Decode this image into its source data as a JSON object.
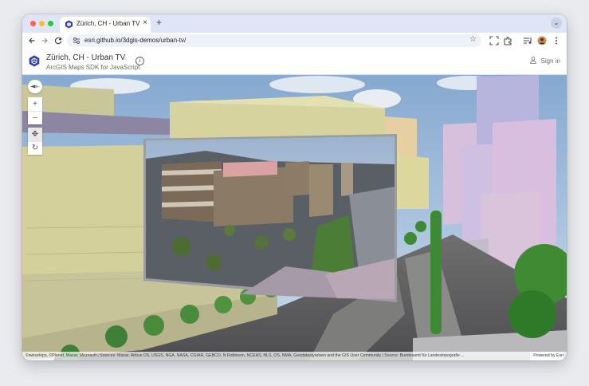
{
  "browser": {
    "tab_title": "Zürich, CH - Urban TV",
    "tab_close": "×",
    "new_tab": "+",
    "tab_menu": "⌄",
    "url": "esri.github.io/3dgis-demos/urban-tv/",
    "bookmark_star": "☆"
  },
  "app": {
    "title": "Zürich, CH - Urban TV",
    "subtitle": "ArcGIS Maps SDK for JavaScript",
    "info": "i",
    "sign_in": "Sign in"
  },
  "map_controls": {
    "zoom_in": "+",
    "zoom_out": "–",
    "pan": "✥",
    "rotate": "↻"
  },
  "attribution": {
    "text": "©swisstopo, ©Planet, Maxar, Microsoft | Sources: Maxar, Airbus DS, USGS, NGA, NASA, CGIAR, GEBCO, N Robinson, NCEAS, NLS, OS, NMA, Geodatastyrelsen and the GIS User Community | Source: Bundesamt für Landestopografie ...",
    "powered_by": "Powered by Esri"
  },
  "colors": {
    "tabbar_bg": "#dfe5f4",
    "traffic_red": "#ff5f57",
    "traffic_yellow": "#febc2e",
    "traffic_green": "#28c840",
    "esri_blue": "#2e3fa6"
  }
}
